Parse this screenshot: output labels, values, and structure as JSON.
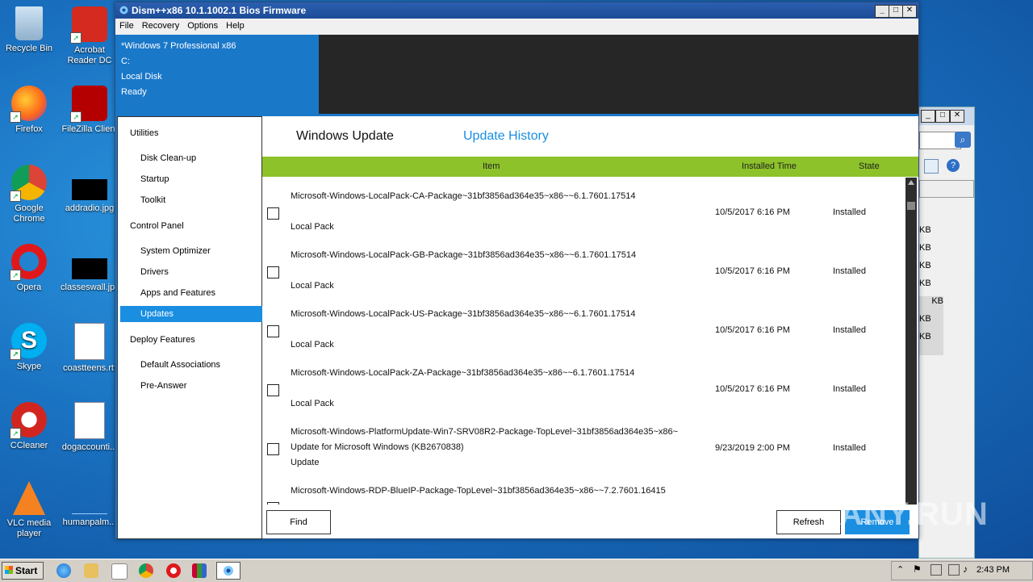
{
  "desktop": {
    "icons": [
      {
        "label": "Recycle Bin"
      },
      {
        "label": "Acrobat Reader DC"
      },
      {
        "label": "Firefox"
      },
      {
        "label": "FileZilla Client"
      },
      {
        "label": "Google Chrome"
      },
      {
        "label": "addradio.jpg"
      },
      {
        "label": "Opera"
      },
      {
        "label": "classeswall.jpg"
      },
      {
        "label": "Skype"
      },
      {
        "label": "coastteens.rtf"
      },
      {
        "label": "CCleaner"
      },
      {
        "label": "dogaccounti..."
      },
      {
        "label": "VLC media player"
      },
      {
        "label": "humanpalm..."
      }
    ]
  },
  "bgwindow": {
    "sizes": [
      "KB",
      "KB",
      "KB",
      "KB",
      "KB",
      "KB",
      "KB"
    ]
  },
  "window": {
    "title": "Dism++x86 10.1.1002.1 Bios Firmware",
    "menu": [
      "File",
      "Recovery",
      "Options",
      "Help"
    ],
    "info": {
      "os": "*Windows 7 Professional x86",
      "drive": "C:",
      "disk": "Local Disk",
      "status": "Ready"
    }
  },
  "sidebar": {
    "utilities": "Utilities",
    "disk_cleanup": "Disk Clean-up",
    "startup": "Startup",
    "toolkit": "Toolkit",
    "control_panel": "Control Panel",
    "system_optimizer": "System Optimizer",
    "drivers": "Drivers",
    "apps_features": "Apps and Features",
    "updates": "Updates",
    "deploy_features": "Deploy Features",
    "default_associations": "Default Associations",
    "pre_answer": "Pre-Answer"
  },
  "tabs": {
    "windows_update": "Windows Update",
    "update_history": "Update History"
  },
  "table": {
    "headers": {
      "item": "Item",
      "time": "Installed Time",
      "state": "State"
    },
    "rows": [
      {
        "name": "Microsoft-Windows-LocalPack-CA-Package~31bf3856ad364e35~x86~~6.1.7601.17514",
        "desc": "",
        "type": "Local Pack",
        "time": "10/5/2017 6:16 PM",
        "state": "Installed"
      },
      {
        "name": "Microsoft-Windows-LocalPack-GB-Package~31bf3856ad364e35~x86~~6.1.7601.17514",
        "desc": "",
        "type": "Local Pack",
        "time": "10/5/2017 6:16 PM",
        "state": "Installed"
      },
      {
        "name": "Microsoft-Windows-LocalPack-US-Package~31bf3856ad364e35~x86~~6.1.7601.17514",
        "desc": "",
        "type": "Local Pack",
        "time": "10/5/2017 6:16 PM",
        "state": "Installed"
      },
      {
        "name": "Microsoft-Windows-LocalPack-ZA-Package~31bf3856ad364e35~x86~~6.1.7601.17514",
        "desc": "",
        "type": "Local Pack",
        "time": "10/5/2017 6:16 PM",
        "state": "Installed"
      },
      {
        "name": "Microsoft-Windows-PlatformUpdate-Win7-SRV08R2-Package-TopLevel~31bf3856ad364e35~x86~",
        "desc": "Update for Microsoft Windows (KB2670838)",
        "type": "Update",
        "time": "9/23/2019 2:00 PM",
        "state": "Installed"
      },
      {
        "name": "Microsoft-Windows-RDP-BlueIP-Package-TopLevel~31bf3856ad364e35~x86~~7.2.7601.16415",
        "desc": "",
        "type": "",
        "time": "",
        "state": ""
      }
    ]
  },
  "buttons": {
    "find": "Find",
    "refresh": "Refresh",
    "remove": "Remove"
  },
  "taskbar": {
    "start": "Start",
    "clock": "2:43 PM"
  },
  "watermark": "ANY.RUN"
}
